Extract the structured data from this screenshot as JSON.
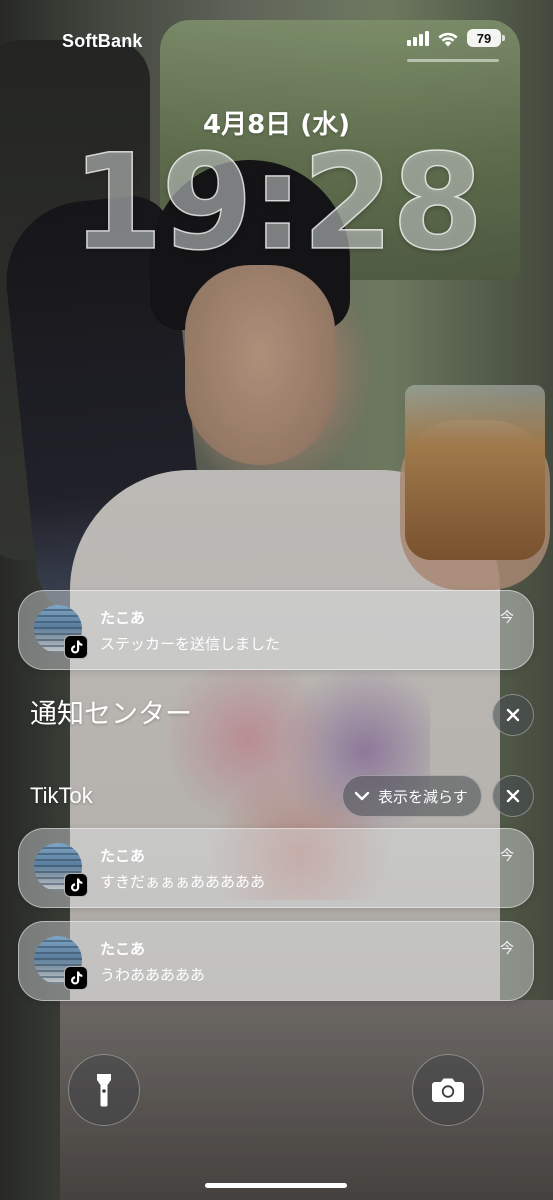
{
  "status_bar": {
    "carrier": "SoftBank",
    "battery_level": "79",
    "icons": [
      "cellular-signal-icon",
      "wifi-icon",
      "battery-icon"
    ]
  },
  "lock_screen": {
    "date": "4月8日 (水)",
    "time": "19:28"
  },
  "pinned_notification": {
    "app": "TikTok",
    "sender": "たこあ",
    "message": "ステッカーを送信しました",
    "time": "今"
  },
  "notification_center": {
    "title": "通知センター",
    "clear_icon": "close-icon"
  },
  "group": {
    "app_name": "TikTok",
    "show_less_label": "表示を減らす",
    "notifications": [
      {
        "sender": "たこあ",
        "message": "すきだぁぁぁあああああ",
        "time": "今"
      },
      {
        "sender": "たこあ",
        "message": "うわあああああ",
        "time": "今"
      }
    ]
  },
  "bottom_controls": {
    "left": "flashlight-icon",
    "right": "camera-icon"
  },
  "colors": {
    "notification_bg": "#e1e4e6",
    "text": "#ffffff",
    "tiktok_badge": "#000000"
  }
}
